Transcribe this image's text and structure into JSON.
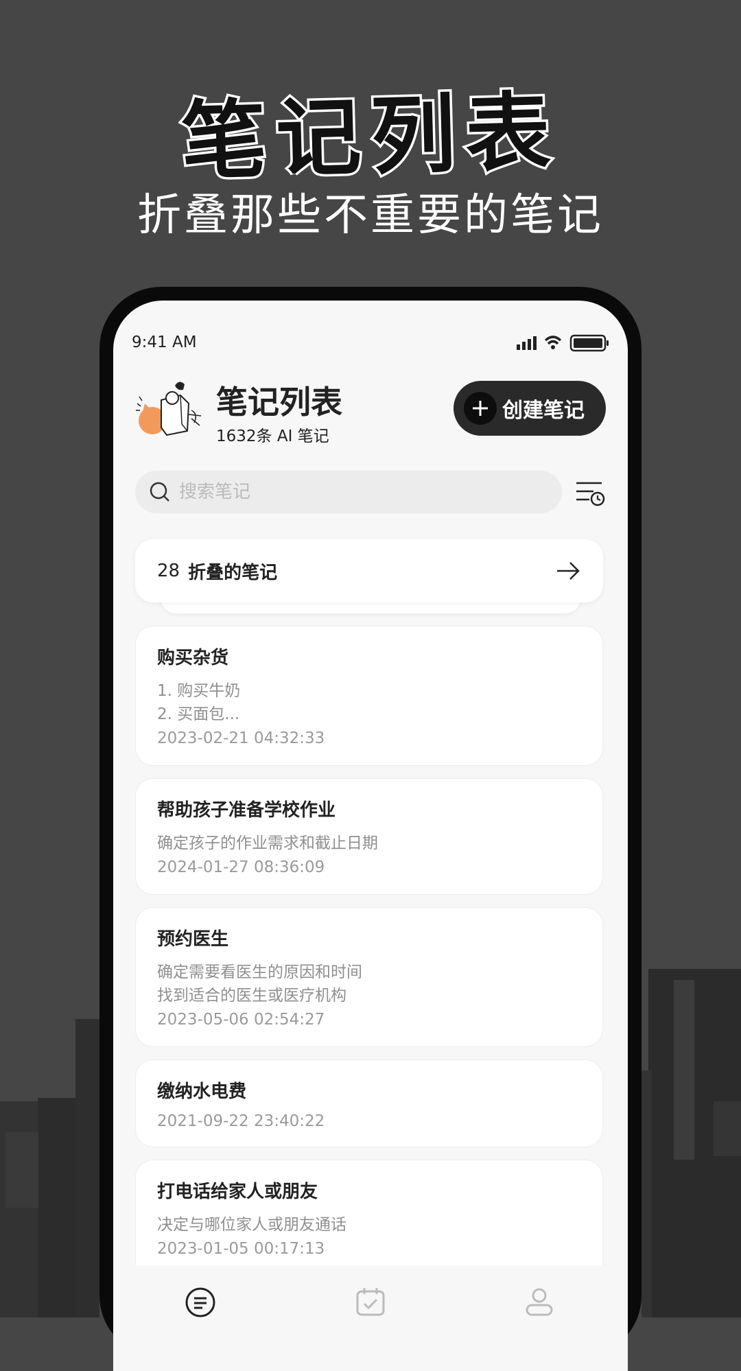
{
  "hero": {
    "title": "笔记列表",
    "subtitle": "折叠那些不重要的笔记"
  },
  "status": {
    "time": "9:41 AM"
  },
  "header": {
    "title": "笔记列表",
    "count": "1632条 AI 笔记",
    "create_label": "创建笔记"
  },
  "search": {
    "placeholder": "搜索笔记"
  },
  "folded": {
    "count": "28",
    "label": "折叠的笔记"
  },
  "notes": [
    {
      "title": "购买杂货",
      "lines": [
        "1. 购买牛奶",
        "2. 买面包..."
      ],
      "date": "2023-02-21 04:32:33"
    },
    {
      "title": "帮助孩子准备学校作业",
      "lines": [
        "确定孩子的作业需求和截止日期"
      ],
      "date": "2024-01-27 08:36:09"
    },
    {
      "title": "预约医生",
      "lines": [
        "确定需要看医生的原因和时间",
        "找到适合的医生或医疗机构"
      ],
      "date": "2023-05-06 02:54:27"
    },
    {
      "title": "缴纳水电费",
      "lines": [],
      "date": "2021-09-22 23:40:22"
    },
    {
      "title": "打电话给家人或朋友",
      "lines": [
        "决定与哪位家人或朋友通话"
      ],
      "date": "2023-01-05 00:17:13"
    }
  ],
  "tabs": [
    "notes-icon",
    "calendar-check-icon",
    "profile-icon"
  ],
  "colors": {
    "background": "#464646",
    "screen": "#f7f7f7",
    "button": "#2a2a2a",
    "accent_orange": "#f29a5c"
  }
}
